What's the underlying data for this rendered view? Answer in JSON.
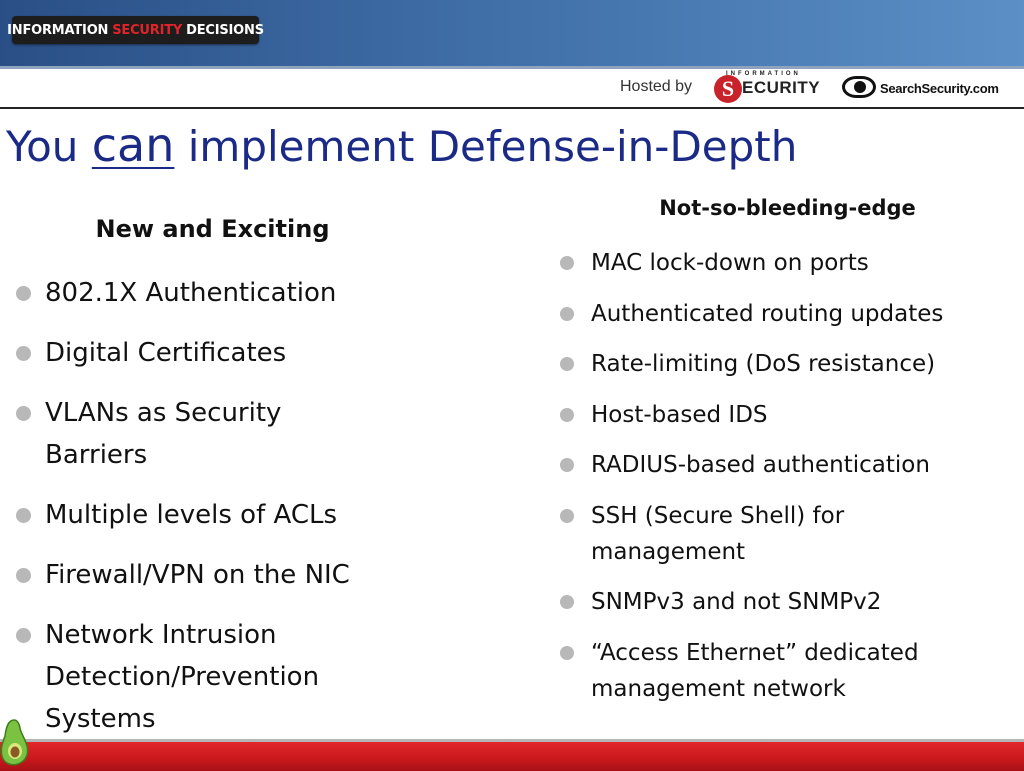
{
  "header": {
    "logo": {
      "part1": "INFORMATION",
      "part2": "SECURITY",
      "part3": "DECISIONS"
    },
    "hosted_by": "Hosted by",
    "info_security_logo": {
      "top": "INFORMATION",
      "word": "ECURITY",
      "s": "S"
    },
    "searchsecurity_logo": "SearchSecurity.com"
  },
  "slide": {
    "title_pre": "You",
    "title_emph": "can",
    "title_post": "implement Defense-in-Depth",
    "left": {
      "heading": "New and Exciting",
      "items": [
        "802.1X Authentication",
        "Digital Certificates",
        "VLANs as Security Barriers",
        "Multiple levels of ACLs",
        "Firewall/VPN on the NIC",
        "Network Intrusion Detection/Prevention Systems"
      ]
    },
    "right": {
      "heading": "Not-so-bleeding-edge",
      "items": [
        "MAC lock-down on ports",
        "Authenticated routing updates",
        "Rate-limiting (DoS resistance)",
        "Host-based IDS",
        "RADIUS-based authentication",
        "SSH (Secure Shell) for management",
        "SNMPv3 and not SNMPv2",
        "“Access Ethernet” dedicated management network"
      ]
    }
  },
  "colors": {
    "title": "#1a2a86",
    "banner": "#3f6da6",
    "footer": "#d2201f",
    "bullet": "#b8b8b8"
  },
  "icons": [
    "searchsecurity-eye-icon",
    "avocado-icon",
    "bullet-dot-icon"
  ]
}
